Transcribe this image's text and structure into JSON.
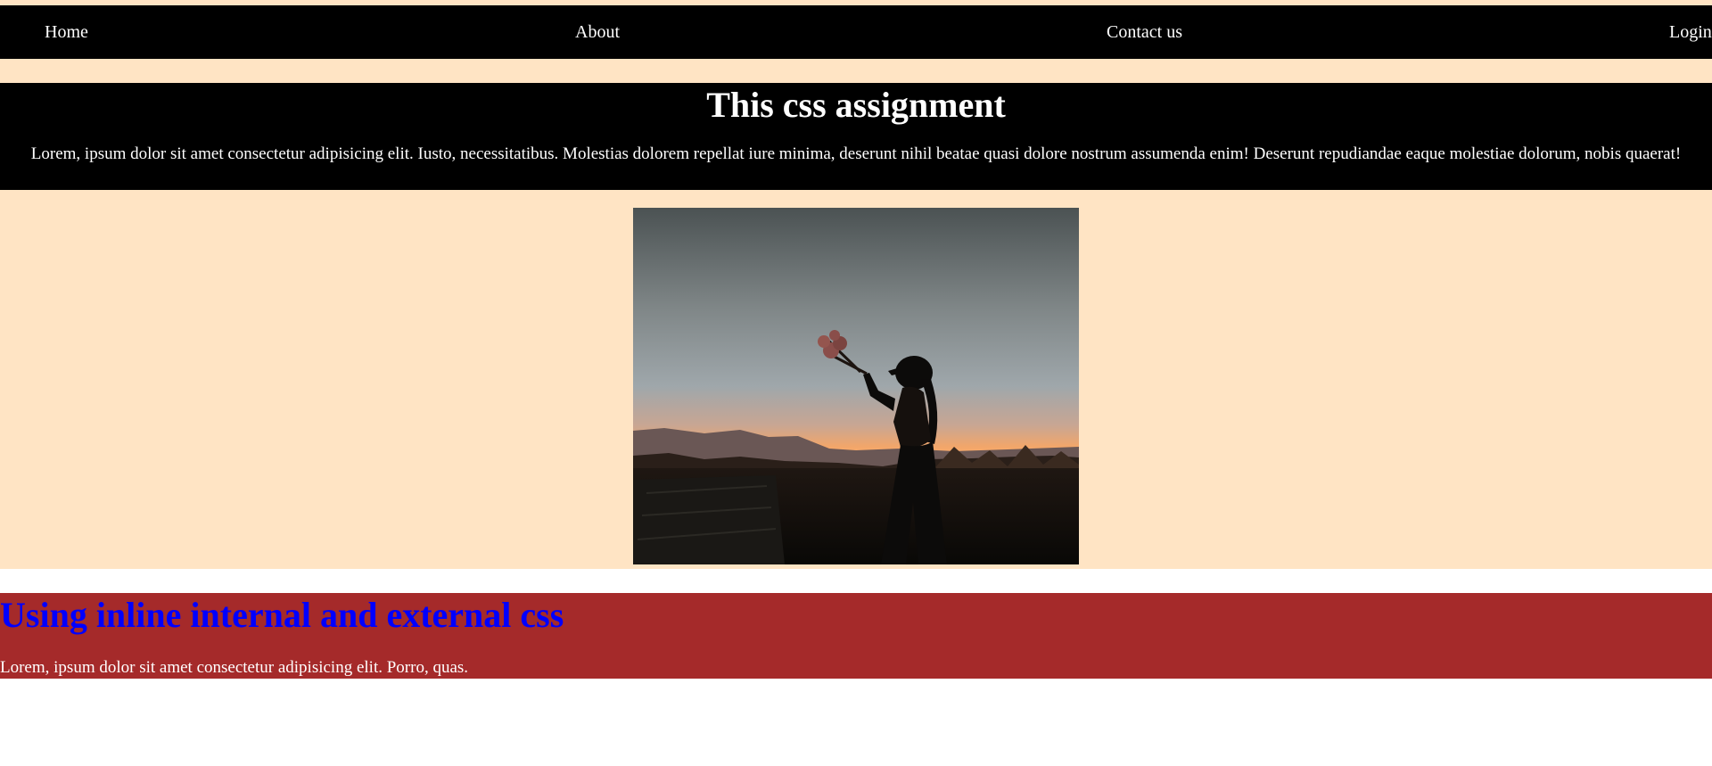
{
  "nav": {
    "items": [
      {
        "label": "Home"
      },
      {
        "label": "About"
      },
      {
        "label": "Contact us"
      },
      {
        "label": "Login"
      }
    ]
  },
  "hero": {
    "title": "This css assignment",
    "text": "Lorem, ipsum dolor sit amet consectetur adipisicing elit. Iusto, necessitatibus. Molestias dolorem repellat iure minima, deserunt nihil beatae quasi dolore nostrum assumenda enim! Deserunt repudiandae eaque molestiae dolorum, nobis quaerat!"
  },
  "section": {
    "title": "Using inline internal and external css",
    "text": "Lorem, ipsum dolor sit amet consectetur adipisicing elit. Porro, quas."
  },
  "colors": {
    "page_background": "#ffe4c4",
    "nav_background": "#000000",
    "section_background": "#a52a2a",
    "section_title": "#0000ff"
  }
}
